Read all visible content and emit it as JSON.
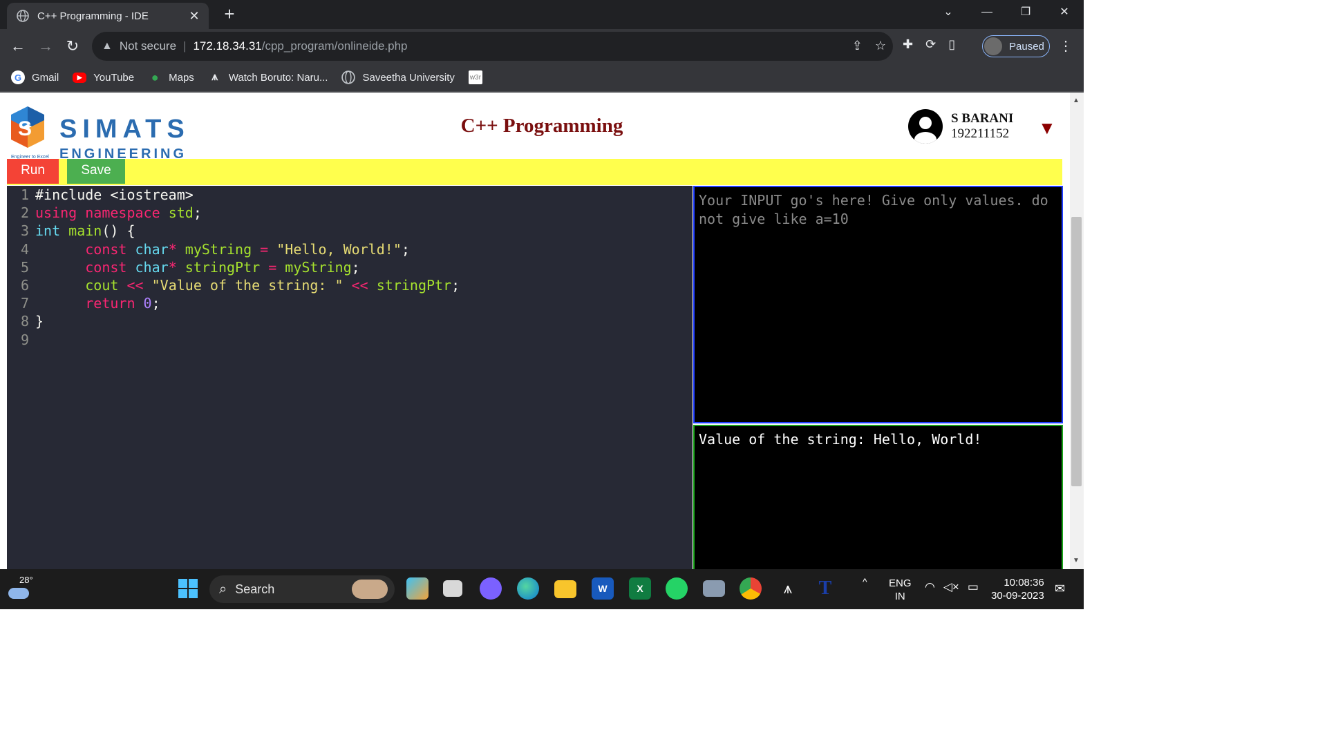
{
  "browser": {
    "tab_title": "C++ Programming - IDE",
    "tab_close": "✕",
    "new_tab": "+",
    "window_controls": [
      "⌄",
      "—",
      "❐",
      "✕"
    ],
    "nav": {
      "back": "←",
      "forward": "→",
      "reload": "↻"
    },
    "address": {
      "warning": "▲",
      "security_label": "Not secure",
      "host": "172.18.34.31",
      "path": "/cpp_program/onlineide.php"
    },
    "profile_label": "Paused",
    "bookmarks": [
      {
        "label": "Gmail",
        "icon": "google-icon"
      },
      {
        "label": "YouTube",
        "icon": "youtube-icon"
      },
      {
        "label": "Maps",
        "icon": "maps-icon"
      },
      {
        "label": "Watch Boruto: Naru...",
        "icon": "anime-site-icon"
      },
      {
        "label": "Saveetha University",
        "icon": "globe-icon"
      },
      {
        "label": "w3r",
        "icon": "w3resource-icon"
      }
    ]
  },
  "header": {
    "logo_line1": "SIMATS",
    "logo_line2": "ENGINEERING",
    "logo_tagline": "Engineer to Excel",
    "title": "C++ Programming",
    "user_name": "S BARANI",
    "user_id": "192211152",
    "caret": "▼"
  },
  "actions": {
    "run_label": "Run",
    "save_label": "Save"
  },
  "editor": {
    "line_numbers": [
      "1",
      "2",
      "3",
      "4",
      "5",
      "6",
      "7",
      "8",
      "9"
    ]
  },
  "io": {
    "input_placeholder": "Your INPUT go's here! Give only values. do not give like a=10",
    "output_text": "Value of the string: Hello, World!"
  },
  "taskbar": {
    "temperature": "28°",
    "search_label": "Search",
    "language_line1": "ENG",
    "language_line2": "IN",
    "time": "10:08:36",
    "date": "30-09-2023",
    "tray_caret": "^"
  },
  "colors": {
    "run": "#f44336",
    "save": "#4caf50",
    "runbar": "#ffff4d",
    "title": "#7a0f0f",
    "editor_bg": "#272935",
    "input_border": "#1e3cff",
    "output_border": "#19a319"
  }
}
